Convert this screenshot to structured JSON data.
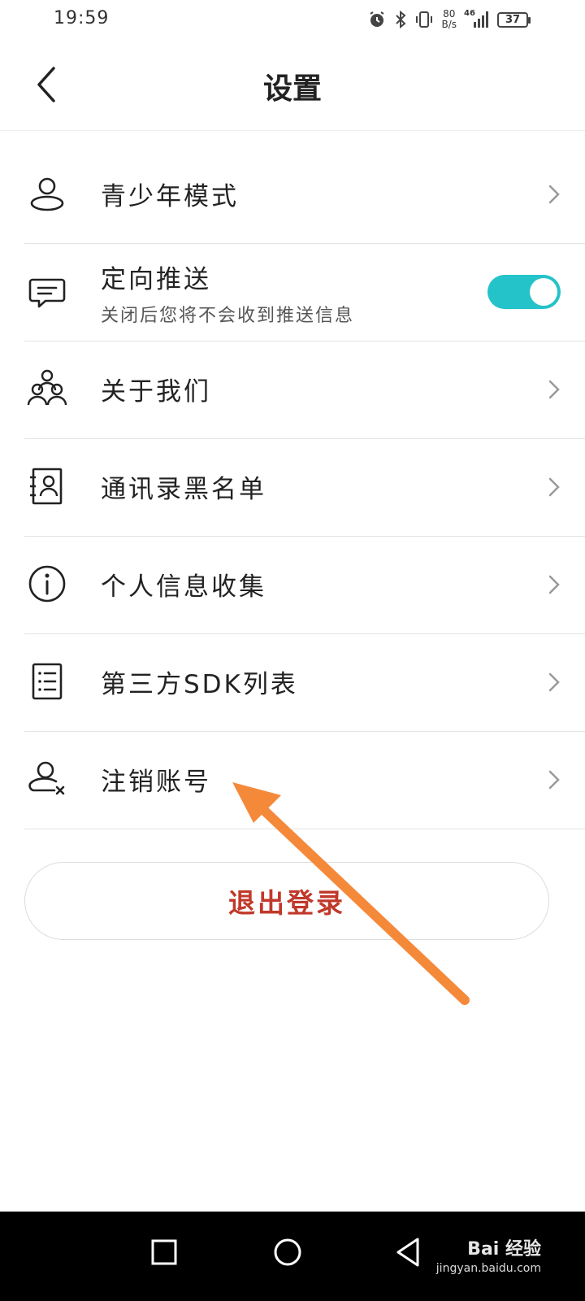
{
  "status_bar": {
    "time": "19:59",
    "net_speed_value": "80",
    "net_speed_unit": "B/s",
    "cell_label": "46",
    "battery": "37",
    "icons": [
      "alarm-icon",
      "bluetooth-icon",
      "vibrate-icon",
      "signal-icon",
      "battery-icon"
    ]
  },
  "header": {
    "title": "设置",
    "back_icon": "back-arrow-icon"
  },
  "settings": {
    "items": [
      {
        "label": "青少年模式",
        "icon": "user-icon"
      },
      {
        "label": "定向推送",
        "sublabel": "关闭后您将不会收到推送信息",
        "icon": "message-icon",
        "toggle_on": true
      },
      {
        "label": "关于我们",
        "icon": "group-icon"
      },
      {
        "label": "通讯录黑名单",
        "icon": "contacts-icon"
      },
      {
        "label": "个人信息收集",
        "icon": "info-icon"
      },
      {
        "label": "第三方SDK列表",
        "icon": "list-icon"
      },
      {
        "label": "注销账号",
        "icon": "user-remove-icon"
      }
    ]
  },
  "logout": {
    "label": "退出登录"
  },
  "colors": {
    "toggle_on": "#24c3c9",
    "logout_text": "#c0392b",
    "annotation_arrow": "#f5893a"
  },
  "nav_bar": {
    "icons": [
      "square-icon",
      "circle-icon",
      "triangle-back-icon"
    ],
    "watermark": "Bai 经验",
    "watermark_url": "jingyan.baidu.com"
  }
}
